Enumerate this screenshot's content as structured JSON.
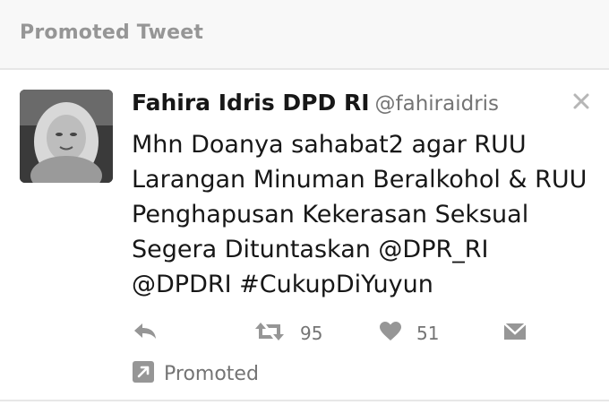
{
  "header": {
    "title": "Promoted Tweet"
  },
  "tweet": {
    "author_name": "Fahira Idris DPD RI",
    "handle": "@fahiraidris",
    "text": "Mhn Doanya sahabat2 agar RUU\nLarangan Minuman Beralkohol & RUU\nPenghapusan Kekerasan Seksual\nSegera Dituntaskan @DPR_RI\n@DPDRI #CukupDiYuyun",
    "retweet_count": "95",
    "like_count": "51",
    "promoted_label": "Promoted"
  },
  "icons": {
    "avatar": "avatar",
    "close": "close-icon",
    "reply": "reply-icon",
    "retweet": "retweet-icon",
    "like": "heart-icon",
    "dm": "envelope-icon",
    "promoted": "promoted-arrow-icon"
  },
  "colors": {
    "header_bg": "#f5f8fa",
    "header_text": "#8899a6",
    "secondary_text": "#657786",
    "primary_text": "#14171a",
    "border": "#e1e8ed"
  }
}
